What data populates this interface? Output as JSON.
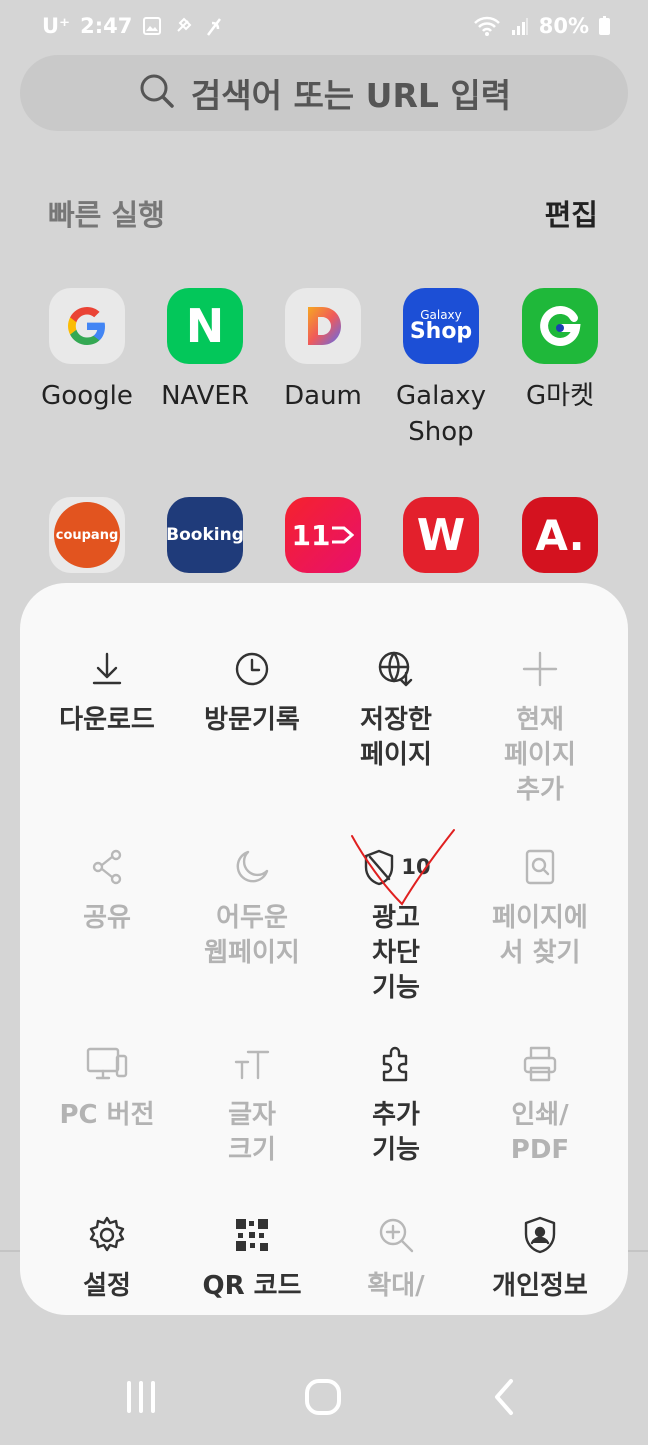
{
  "status_bar": {
    "carrier": "U⁺",
    "time": "2:47",
    "battery": "80%"
  },
  "search": {
    "placeholder": "검색어 또는 URL 입력"
  },
  "quick_access": {
    "title": "빠른 실행",
    "edit_label": "편집",
    "tiles": [
      {
        "label": "Google",
        "icon": "google-logo"
      },
      {
        "label": "NAVER",
        "icon": "naver-logo"
      },
      {
        "label": "Daum",
        "icon": "daum-logo"
      },
      {
        "label": "Galaxy\nShop",
        "icon": "galaxy-shop-logo",
        "icon_text_top": "Galaxy",
        "icon_text_bottom": "Shop"
      },
      {
        "label": "G마켓",
        "icon": "gmarket-logo"
      },
      {
        "label": "",
        "icon": "coupang-logo",
        "icon_text": "coupang"
      },
      {
        "label": "",
        "icon": "booking-logo",
        "icon_text": "Booking"
      },
      {
        "label": "",
        "icon": "11st-logo",
        "icon_text": "11"
      },
      {
        "label": "",
        "icon": "wemakeprice-logo",
        "icon_text": "W"
      },
      {
        "label": "",
        "icon": "auction-logo",
        "icon_text": "A."
      }
    ]
  },
  "menu": {
    "items": [
      {
        "label": "다운로드",
        "icon": "download-icon",
        "enabled": true
      },
      {
        "label": "방문기록",
        "icon": "history-icon",
        "enabled": true
      },
      {
        "label": "저장한\n페이지",
        "icon": "saved-pages-icon",
        "enabled": true
      },
      {
        "label": "현재\n페이지\n추가",
        "icon": "add-icon",
        "enabled": false
      },
      {
        "label": "공유",
        "icon": "share-icon",
        "enabled": false
      },
      {
        "label": "어두운\n웹페이지",
        "icon": "dark-mode-icon",
        "enabled": false
      },
      {
        "label": "광고\n차단\n기능",
        "icon": "ad-block-icon",
        "enabled": true,
        "badge": "10"
      },
      {
        "label": "페이지에\n서 찾기",
        "icon": "find-in-page-icon",
        "enabled": false
      },
      {
        "label": "PC 버전",
        "icon": "desktop-icon",
        "enabled": false
      },
      {
        "label": "글자\n크기",
        "icon": "text-size-icon",
        "enabled": false
      },
      {
        "label": "추가\n기능",
        "icon": "add-ons-icon",
        "enabled": true
      },
      {
        "label": "인쇄/\nPDF",
        "icon": "print-icon",
        "enabled": false
      },
      {
        "label": "설정",
        "icon": "settings-icon",
        "enabled": true
      },
      {
        "label": "QR 코드",
        "icon": "qr-code-icon",
        "enabled": true
      },
      {
        "label": "확대/",
        "icon": "zoom-icon",
        "enabled": false
      },
      {
        "label": "개인정보",
        "icon": "privacy-icon",
        "enabled": true
      }
    ]
  },
  "colors": {
    "background": "#d5d5d5",
    "panel": "#f9f9f9",
    "annotation": "#e02020"
  }
}
